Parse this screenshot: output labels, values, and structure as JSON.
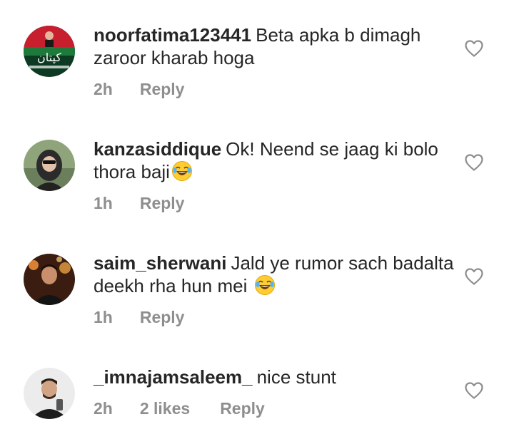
{
  "comments": [
    {
      "username": "noorfatima123441",
      "text": "Beta apka b dimagh zaroor kharab hoga",
      "time": "2h",
      "likes": "",
      "reply_label": "Reply",
      "avatar_text": "کپتان"
    },
    {
      "username": "kanzasiddique",
      "text": "Ok! Neend se jaag ki bolo thora baji",
      "time": "1h",
      "likes": "",
      "reply_label": "Reply"
    },
    {
      "username": "saim_sherwani",
      "text": "Jald ye rumor sach badalta deekh rha hun mei",
      "time": "1h",
      "likes": "",
      "reply_label": "Reply"
    },
    {
      "username": "_imnajamsaleem_",
      "text": "nice stunt",
      "time": "2h",
      "likes": "2 likes",
      "reply_label": "Reply"
    }
  ],
  "icons": {
    "like": "heart-outline-icon",
    "emoji": "laughing-emoji"
  },
  "colors": {
    "text": "#262626",
    "meta": "#8e8e8e",
    "heart": "#8e8e8e"
  }
}
